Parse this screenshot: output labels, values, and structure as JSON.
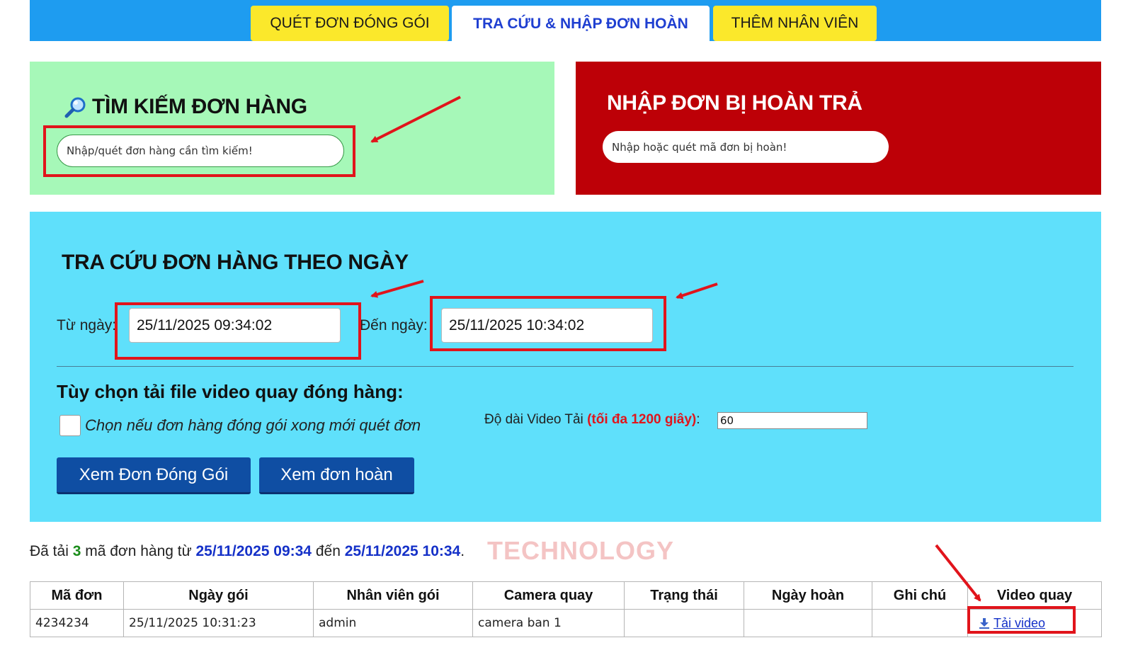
{
  "tabs": [
    {
      "label": "QUÉT ĐƠN ĐÓNG GÓI",
      "active": false
    },
    {
      "label": "TRA CỨU & NHẬP ĐƠN HOÀN",
      "active": true
    },
    {
      "label": "THÊM NHÂN VIÊN",
      "active": false
    }
  ],
  "search_panel": {
    "title": "TÌM KIẾM ĐƠN HÀNG",
    "icon": "magnifier-icon",
    "placeholder": "Nhập/quét đơn hàng cần tìm kiếm!"
  },
  "return_panel": {
    "title": "NHẬP ĐƠN BỊ HOÀN TRẢ",
    "placeholder": "Nhập hoặc quét mã đơn bị hoàn!"
  },
  "date_panel": {
    "title": "TRA CỨU ĐƠN HÀNG THEO NGÀY",
    "from_label": "Từ ngày:",
    "from_value": "25/11/2025 09:34:02",
    "to_label": "Đến ngày:",
    "to_value": "25/11/2025 10:34:02",
    "options_title": "Tùy chọn tải file video quay đóng hàng:",
    "checkbox_label": "Chọn nếu đơn hàng đóng gói xong mới quét đơn",
    "checkbox_checked": false,
    "duration_label": "Độ dài Video Tải",
    "duration_note": "(tối đa 1200 giây)",
    "duration_colon": ":",
    "duration_value": "60",
    "btn_packed": "Xem Đơn Đóng Gói",
    "btn_returned": "Xem đơn hoàn"
  },
  "summary": {
    "prefix": "Đã tải",
    "count": "3",
    "middle": "mã đơn hàng từ",
    "from": "25/11/2025 09:34",
    "to_word": "đến",
    "to": "25/11/2025 10:34",
    "end": "."
  },
  "watermark": "TECHNOLOGY",
  "table": {
    "headers": [
      "Mã đơn",
      "Ngày gói",
      "Nhân viên gói",
      "Camera quay",
      "Trạng thái",
      "Ngày hoàn",
      "Ghi chú",
      "Video quay"
    ],
    "rows": [
      {
        "code": "4234234",
        "packed_at": "25/11/2025 10:31:23",
        "staff": "admin",
        "camera": "camera ban 1",
        "status": "",
        "returned_at": "",
        "note": "",
        "video_link": "Tải video"
      }
    ]
  },
  "colors": {
    "tab_bar": "#1e9cf0",
    "tab_yellow": "#fbe82b",
    "search_panel": "#a6f8b8",
    "return_panel": "#bd0007",
    "date_panel": "#5fe0fb",
    "button": "#0f4ea3",
    "annotation_red": "#e1141b"
  }
}
